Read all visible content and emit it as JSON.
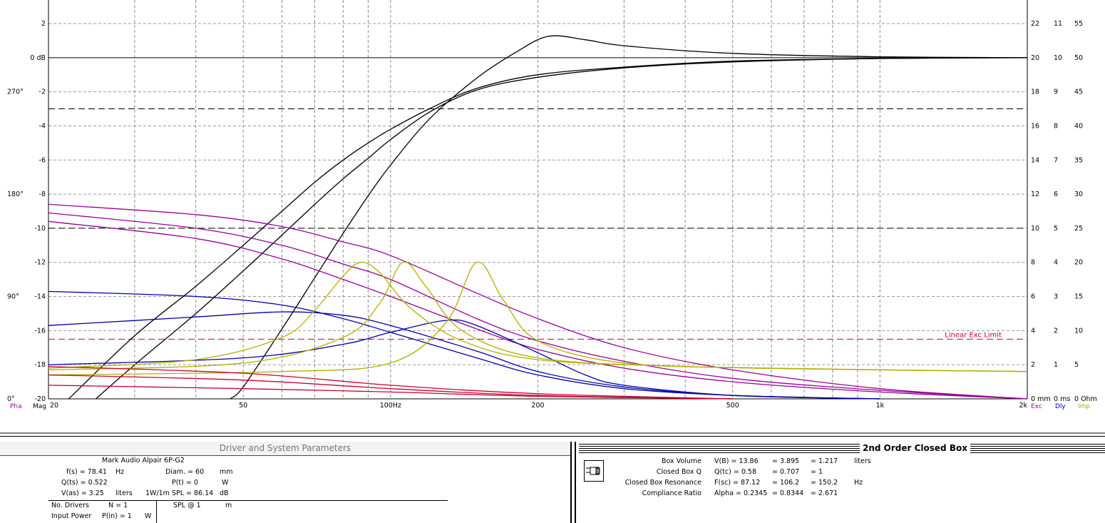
{
  "chart_data": {
    "type": "line",
    "x_scale": "log",
    "xlim": [
      20,
      2000
    ],
    "x_ticks": [
      {
        "v": 20,
        "label": "20"
      },
      {
        "v": 50,
        "label": "50"
      },
      {
        "v": 100,
        "label": "100Hz"
      },
      {
        "v": 200,
        "label": "200"
      },
      {
        "v": 500,
        "label": "500"
      },
      {
        "v": 1000,
        "label": "1k"
      },
      {
        "v": 2000,
        "label": "2k"
      }
    ],
    "x_grid": [
      20,
      30,
      40,
      50,
      60,
      70,
      80,
      90,
      100,
      200,
      300,
      400,
      500,
      600,
      700,
      800,
      900,
      1000,
      2000
    ],
    "mag_axis": {
      "ylim": [
        -20,
        4
      ],
      "ticks": [
        {
          "v": 2,
          "label": "2"
        },
        {
          "v": 0,
          "label": "0 dB"
        },
        {
          "v": -2,
          "label": "-2"
        },
        {
          "v": -4,
          "label": "-4"
        },
        {
          "v": -6,
          "label": "-6"
        },
        {
          "v": -8,
          "label": "-8"
        },
        {
          "v": -10,
          "label": "-10"
        },
        {
          "v": -12,
          "label": "-12"
        },
        {
          "v": -14,
          "label": "-14"
        },
        {
          "v": -16,
          "label": "-16"
        },
        {
          "v": -18,
          "label": "-18"
        },
        {
          "v": -20,
          "label": "-20"
        }
      ],
      "label": "Mag"
    },
    "phase_axis": {
      "ticks": [
        {
          "v": -2,
          "label": "270°"
        },
        {
          "v": -8,
          "label": "180°"
        },
        {
          "v": -14,
          "label": "90°"
        },
        {
          "v": -20,
          "label": "0°"
        }
      ],
      "label": "Pha"
    },
    "right_axes": [
      {
        "label": "Exc",
        "color": "#b000b0",
        "ticks": [
          "22",
          "20",
          "18",
          "16",
          "14",
          "12",
          "10",
          "8",
          "6",
          "4",
          "2",
          "0 mm"
        ]
      },
      {
        "label": "Dly",
        "color": "#0000c0",
        "ticks": [
          "11",
          "10",
          "9",
          "8",
          "7",
          "6",
          "5",
          "4",
          "3",
          "2",
          "1",
          "0 ms"
        ]
      },
      {
        "label": "Imp",
        "color": "#a8a800",
        "ticks": [
          "55",
          "50",
          "45",
          "40",
          "35",
          "30",
          "25",
          "20",
          "15",
          "10",
          "5",
          "0 Ohm"
        ]
      }
    ],
    "right_tick_values": [
      2,
      0,
      -2,
      -4,
      -6,
      -8,
      -10,
      -12,
      -14,
      -16,
      -18,
      -20
    ],
    "ref_lines": [
      {
        "y": 0,
        "style": "solid",
        "color": "#000000"
      },
      {
        "y": -3,
        "style": "dashed",
        "color": "#000000"
      },
      {
        "y": -10,
        "style": "dashed",
        "color": "#000000"
      },
      {
        "y": -16.5,
        "style": "dashed",
        "color": "#cc0033",
        "label": "Linear Exc Limit"
      }
    ],
    "series": [
      {
        "kind": "mag",
        "color": "#000000",
        "points": [
          [
            22,
            -20
          ],
          [
            30,
            -16.3
          ],
          [
            40,
            -13.4
          ],
          [
            50,
            -11
          ],
          [
            60,
            -9
          ],
          [
            70,
            -7.3
          ],
          [
            80,
            -6
          ],
          [
            90,
            -5
          ],
          [
            100,
            -4.2
          ],
          [
            120,
            -3
          ],
          [
            150,
            -1.8
          ],
          [
            200,
            -1
          ],
          [
            300,
            -0.55
          ],
          [
            500,
            -0.2
          ],
          [
            1000,
            -0.05
          ],
          [
            2000,
            0
          ]
        ]
      },
      {
        "kind": "mag",
        "color": "#000000",
        "points": [
          [
            25,
            -20
          ],
          [
            30,
            -18
          ],
          [
            40,
            -15
          ],
          [
            50,
            -12.5
          ],
          [
            60,
            -10.4
          ],
          [
            70,
            -8.6
          ],
          [
            80,
            -7.1
          ],
          [
            90,
            -5.9
          ],
          [
            100,
            -4.8
          ],
          [
            120,
            -3.2
          ],
          [
            150,
            -1.9
          ],
          [
            200,
            -1.15
          ],
          [
            300,
            -0.6
          ],
          [
            500,
            -0.25
          ],
          [
            1000,
            -0.05
          ],
          [
            2000,
            0
          ]
        ]
      },
      {
        "kind": "mag",
        "color": "#000000",
        "points": [
          [
            47,
            -20
          ],
          [
            50,
            -19.3
          ],
          [
            60,
            -15.9
          ],
          [
            70,
            -12.9
          ],
          [
            80,
            -10.3
          ],
          [
            90,
            -8.1
          ],
          [
            100,
            -6.3
          ],
          [
            120,
            -3.6
          ],
          [
            150,
            -1.2
          ],
          [
            180,
            0.3
          ],
          [
            210,
            1.25
          ],
          [
            250,
            1.05
          ],
          [
            300,
            0.7
          ],
          [
            500,
            0.25
          ],
          [
            1000,
            0.05
          ],
          [
            2000,
            0
          ]
        ]
      },
      {
        "kind": "exc",
        "color": "#990099",
        "points": [
          [
            20,
            -8.6
          ],
          [
            40,
            -9.2
          ],
          [
            60,
            -9.9
          ],
          [
            80,
            -10.8
          ],
          [
            100,
            -11.6
          ],
          [
            150,
            -13.8
          ],
          [
            200,
            -15.3
          ],
          [
            300,
            -17
          ],
          [
            500,
            -18.3
          ],
          [
            1000,
            -19.4
          ],
          [
            2000,
            -20
          ]
        ]
      },
      {
        "kind": "exc",
        "color": "#990099",
        "points": [
          [
            20,
            -9.1
          ],
          [
            40,
            -10
          ],
          [
            60,
            -11
          ],
          [
            80,
            -12.1
          ],
          [
            100,
            -13
          ],
          [
            150,
            -15.3
          ],
          [
            200,
            -16.6
          ],
          [
            300,
            -17.8
          ],
          [
            500,
            -18.8
          ],
          [
            1000,
            -19.5
          ],
          [
            2000,
            -20
          ]
        ]
      },
      {
        "kind": "exc",
        "color": "#990099",
        "points": [
          [
            20,
            -9.6
          ],
          [
            40,
            -10.6
          ],
          [
            60,
            -11.8
          ],
          [
            80,
            -13
          ],
          [
            100,
            -14
          ],
          [
            150,
            -15.9
          ],
          [
            200,
            -17.1
          ],
          [
            300,
            -18.2
          ],
          [
            500,
            -19
          ],
          [
            1000,
            -19.6
          ],
          [
            2000,
            -20
          ]
        ]
      },
      {
        "kind": "dly",
        "color": "#0000aa",
        "points": [
          [
            20,
            -13.7
          ],
          [
            40,
            -14
          ],
          [
            60,
            -14.5
          ],
          [
            80,
            -15.3
          ],
          [
            100,
            -16.1
          ],
          [
            150,
            -17.6
          ],
          [
            200,
            -18.6
          ],
          [
            300,
            -19.4
          ],
          [
            500,
            -19.8
          ],
          [
            1000,
            -20
          ]
        ]
      },
      {
        "kind": "dly",
        "color": "#0000aa",
        "points": [
          [
            20,
            -15.7
          ],
          [
            40,
            -15.2
          ],
          [
            60,
            -14.9
          ],
          [
            80,
            -15.1
          ],
          [
            100,
            -15.7
          ],
          [
            150,
            -17.2
          ],
          [
            200,
            -18.4
          ],
          [
            300,
            -19.3
          ],
          [
            500,
            -19.8
          ],
          [
            1000,
            -20
          ]
        ]
      },
      {
        "kind": "dly",
        "color": "#0000aa",
        "points": [
          [
            20,
            -18
          ],
          [
            50,
            -17.6
          ],
          [
            80,
            -16.8
          ],
          [
            100,
            -16.1
          ],
          [
            130,
            -15.4
          ],
          [
            150,
            -15.7
          ],
          [
            200,
            -17.3
          ],
          [
            250,
            -18.6
          ],
          [
            300,
            -19.2
          ],
          [
            500,
            -19.8
          ],
          [
            1000,
            -20
          ]
        ]
      },
      {
        "kind": "imp",
        "color": "#b0b000",
        "points": [
          [
            20,
            -18.2
          ],
          [
            40,
            -17.7
          ],
          [
            60,
            -16.4
          ],
          [
            70,
            -14.8
          ],
          [
            80,
            -12.8
          ],
          [
            87,
            -12
          ],
          [
            95,
            -12.6
          ],
          [
            110,
            -14.7
          ],
          [
            140,
            -16.6
          ],
          [
            200,
            -17.7
          ],
          [
            400,
            -18.1
          ],
          [
            1000,
            -18.3
          ],
          [
            2000,
            -18.4
          ]
        ]
      },
      {
        "kind": "imp",
        "color": "#b0b000",
        "points": [
          [
            20,
            -18.3
          ],
          [
            50,
            -17.9
          ],
          [
            80,
            -16.4
          ],
          [
            95,
            -14.4
          ],
          [
            106,
            -12
          ],
          [
            118,
            -13.4
          ],
          [
            140,
            -16
          ],
          [
            200,
            -17.6
          ],
          [
            400,
            -18.1
          ],
          [
            1000,
            -18.3
          ],
          [
            2000,
            -18.4
          ]
        ]
      },
      {
        "kind": "imp",
        "color": "#b0b000",
        "points": [
          [
            20,
            -18.6
          ],
          [
            60,
            -18.4
          ],
          [
            100,
            -17.9
          ],
          [
            130,
            -15.5
          ],
          [
            150,
            -12
          ],
          [
            170,
            -14.2
          ],
          [
            200,
            -16.6
          ],
          [
            300,
            -17.9
          ],
          [
            600,
            -18.2
          ],
          [
            2000,
            -18.4
          ]
        ]
      },
      {
        "kind": "spl",
        "color": "#cc0033",
        "points": [
          [
            20,
            -18.1
          ],
          [
            50,
            -18.5
          ],
          [
            100,
            -19.2
          ],
          [
            200,
            -19.7
          ],
          [
            500,
            -20
          ]
        ]
      },
      {
        "kind": "spl",
        "color": "#cc0033",
        "points": [
          [
            20,
            -18.6
          ],
          [
            50,
            -18.9
          ],
          [
            100,
            -19.4
          ],
          [
            200,
            -19.8
          ],
          [
            500,
            -20
          ]
        ]
      },
      {
        "kind": "spl",
        "color": "#cc0033",
        "points": [
          [
            20,
            -19.2
          ],
          [
            50,
            -19.4
          ],
          [
            100,
            -19.6
          ],
          [
            200,
            -19.85
          ],
          [
            500,
            -20
          ]
        ]
      }
    ]
  },
  "driver_panel": {
    "title": "Driver and System Parameters",
    "driver_name": "Mark Audio  Alpair 6P-G2",
    "fs_label": "f(s) = 78.41",
    "fs_unit": "Hz",
    "qts_label": "Q(ts) = 0.522",
    "vas_label": "V(as) = 3.25",
    "vas_unit": "liters",
    "diam_label": "Diam. = 60",
    "diam_unit": "mm",
    "pt_label": "P(t) = 0",
    "pt_unit": "W",
    "spl_label": "1W/1m SPL = 86.14",
    "spl_unit": "dB",
    "drivers_label": "No. Drivers",
    "drivers_value": "N = 1",
    "power_label": "Input Power",
    "power_value": "P(in) = 1",
    "power_unit": "W",
    "splat_label": "SPL @ 1",
    "splat_unit": "m"
  },
  "box_panel": {
    "title": "2nd Order Closed Box",
    "rows": [
      {
        "name": "Box Volume",
        "sym": "V(B) = 13.86",
        "v2": "= 3.895",
        "v3": "= 1.217",
        "unit": "liters"
      },
      {
        "name": "Closed Box Q",
        "sym": "Q(tc) = 0.58",
        "v2": "= 0.707",
        "v3": "= 1",
        "unit": ""
      },
      {
        "name": "Closed Box Resonance",
        "sym": "F(sc) = 87.12",
        "v2": "= 106.2",
        "v3": "= 150.2",
        "unit": "Hz"
      },
      {
        "name": "Compliance Ratio",
        "sym": "Alpha = 0.2345",
        "v2": "= 0.8344",
        "v3": "= 2.671",
        "unit": ""
      }
    ]
  }
}
